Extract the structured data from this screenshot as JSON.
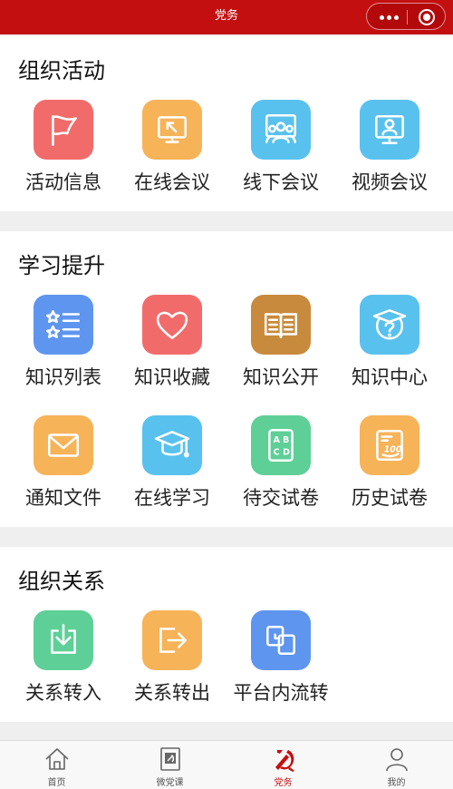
{
  "topbar": {
    "title": "党务"
  },
  "sections": [
    {
      "title": "组织活动",
      "items": [
        {
          "label": "活动信息",
          "icon": "flag-icon",
          "color": "#f26b6b"
        },
        {
          "label": "在线会议",
          "icon": "screen-pointer-icon",
          "color": "#f7b358"
        },
        {
          "label": "线下会议",
          "icon": "group-meeting-icon",
          "color": "#59c1ee"
        },
        {
          "label": "视频会议",
          "icon": "video-monitor-icon",
          "color": "#59c1ee"
        }
      ]
    },
    {
      "title": "学习提升",
      "items": [
        {
          "label": "知识列表",
          "icon": "star-list-icon",
          "color": "#5e95ef"
        },
        {
          "label": "知识收藏",
          "icon": "heart-icon",
          "color": "#f26b6b"
        },
        {
          "label": "知识公开",
          "icon": "open-book-icon",
          "color": "#c88a3c"
        },
        {
          "label": "知识中心",
          "icon": "graduation-question-icon",
          "color": "#59c1ee"
        },
        {
          "label": "通知文件",
          "icon": "envelope-icon",
          "color": "#f7b358"
        },
        {
          "label": "在线学习",
          "icon": "graduation-cap-icon",
          "color": "#59c1ee"
        },
        {
          "label": "待交试卷",
          "icon": "abcd-paper-icon",
          "color": "#5ecf97"
        },
        {
          "label": "历史试卷",
          "icon": "scored-paper-icon",
          "color": "#f7b358"
        }
      ]
    },
    {
      "title": "组织关系",
      "items": [
        {
          "label": "关系转入",
          "icon": "import-icon",
          "color": "#5ecf97"
        },
        {
          "label": "关系转出",
          "icon": "export-icon",
          "color": "#f7b358"
        },
        {
          "label": "平台内流转",
          "icon": "transfer-icon",
          "color": "#5e95ef"
        }
      ]
    }
  ],
  "tabbar": {
    "active": 2,
    "active_color": "#c40f10",
    "items": [
      {
        "label": "首页",
        "icon": "home-icon"
      },
      {
        "label": "微党课",
        "icon": "party-book-icon"
      },
      {
        "label": "党务",
        "icon": "party-emblem-icon"
      },
      {
        "label": "我的",
        "icon": "user-icon"
      }
    ]
  }
}
